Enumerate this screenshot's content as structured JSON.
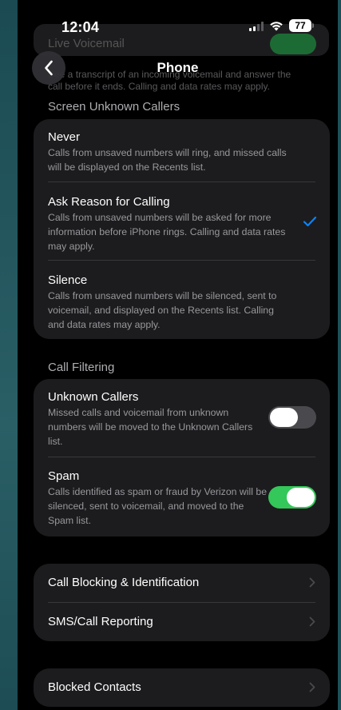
{
  "status": {
    "time": "12:04",
    "battery": "77"
  },
  "behind_header": {
    "title": "Live Voicemail",
    "description": "See a transcript of an incoming voicemail and answer the call before it ends. Calling and data rates may apply."
  },
  "nav": {
    "title": "Phone"
  },
  "screen_unknown": {
    "header": "Screen Unknown Callers",
    "options": [
      {
        "title": "Never",
        "desc": "Calls from unsaved numbers will ring, and missed calls will be displayed on the Recents list.",
        "selected": false
      },
      {
        "title": "Ask Reason for Calling",
        "desc": "Calls from unsaved numbers will be asked for more information before iPhone rings. Calling and data rates may apply.",
        "selected": true
      },
      {
        "title": "Silence",
        "desc": "Calls from unsaved numbers will be silenced, sent to voicemail, and displayed on the Recents list. Calling and data rates may apply.",
        "selected": false
      }
    ]
  },
  "call_filtering": {
    "header": "Call Filtering",
    "items": [
      {
        "title": "Unknown Callers",
        "desc": "Missed calls and voicemail from unknown numbers will be moved to the Unknown Callers list.",
        "enabled": false
      },
      {
        "title": "Spam",
        "desc": "Calls identified as spam or fraud by Verizon will be silenced, sent to voicemail, and moved to the Spam list.",
        "enabled": true
      }
    ]
  },
  "links": [
    {
      "label": "Call Blocking & Identification"
    },
    {
      "label": "SMS/Call Reporting"
    }
  ],
  "blocked": {
    "label": "Blocked Contacts"
  },
  "colors": {
    "accent": "#0a84ff",
    "toggle_on": "#34c759",
    "card": "#1c1c1e"
  }
}
